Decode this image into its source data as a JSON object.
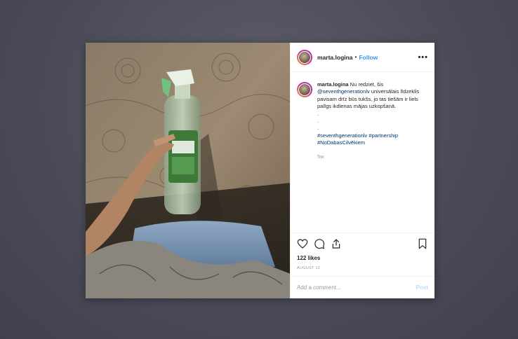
{
  "post": {
    "username": "marta.logina",
    "separator": "•",
    "follow_label": "Follow",
    "more_label": "•••",
    "caption": {
      "username": "marta.logina",
      "text_1": " Nu redziet, šis ",
      "mention": "@seventhgenerationlv",
      "text_2": " universālais līdzeklis pavisam drīz būs tukšs, jo tas tiešām ir liels palīgs ikdienas mājas uzkopšanā.",
      "dots": [
        ".",
        ".",
        "."
      ],
      "hashtag_1": "#seventhgenerationlv",
      "hashtag_2": "#partnership",
      "hashtag_3": "#NoDabasCilvēkiem"
    },
    "time_ago": "5w",
    "likes": "122 likes",
    "date": "AUGUST 12",
    "comment_placeholder": "Add a comment...",
    "post_label": "Post"
  },
  "icons": [
    "heart-icon",
    "comment-icon",
    "share-icon",
    "bookmark-icon"
  ],
  "colors": {
    "link": "#003569",
    "follow": "#3897f0",
    "post_disabled": "#b2dffc"
  }
}
